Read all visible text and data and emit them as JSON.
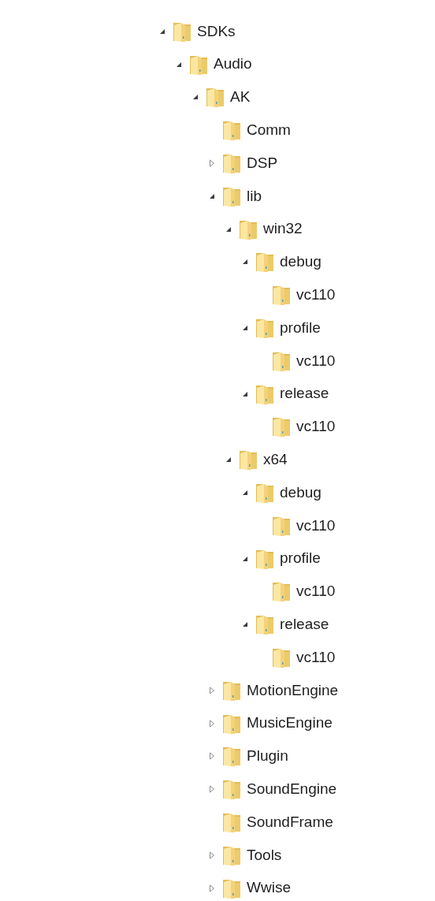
{
  "tree": [
    {
      "label": "SDKs",
      "expanded": true,
      "children": [
        {
          "label": "Audio",
          "expanded": true,
          "children": [
            {
              "label": "AK",
              "expanded": true,
              "children": [
                {
                  "label": "Comm"
                },
                {
                  "label": "DSP",
                  "expanded": false
                },
                {
                  "label": "lib",
                  "expanded": true,
                  "children": [
                    {
                      "label": "win32",
                      "expanded": true,
                      "children": [
                        {
                          "label": "debug",
                          "expanded": true,
                          "children": [
                            {
                              "label": "vc110"
                            }
                          ]
                        },
                        {
                          "label": "profile",
                          "expanded": true,
                          "children": [
                            {
                              "label": "vc110"
                            }
                          ]
                        },
                        {
                          "label": "release",
                          "expanded": true,
                          "children": [
                            {
                              "label": "vc110"
                            }
                          ]
                        }
                      ]
                    },
                    {
                      "label": "x64",
                      "expanded": true,
                      "children": [
                        {
                          "label": "debug",
                          "expanded": true,
                          "children": [
                            {
                              "label": "vc110"
                            }
                          ]
                        },
                        {
                          "label": "profile",
                          "expanded": true,
                          "children": [
                            {
                              "label": "vc110"
                            }
                          ]
                        },
                        {
                          "label": "release",
                          "expanded": true,
                          "children": [
                            {
                              "label": "vc110"
                            }
                          ]
                        }
                      ]
                    }
                  ]
                },
                {
                  "label": "MotionEngine",
                  "expanded": false
                },
                {
                  "label": "MusicEngine",
                  "expanded": false
                },
                {
                  "label": "Plugin",
                  "expanded": false
                },
                {
                  "label": "SoundEngine",
                  "expanded": false
                },
                {
                  "label": "SoundFrame"
                },
                {
                  "label": "Tools",
                  "expanded": false
                },
                {
                  "label": "Wwise",
                  "expanded": false
                }
              ]
            }
          ]
        }
      ]
    }
  ]
}
